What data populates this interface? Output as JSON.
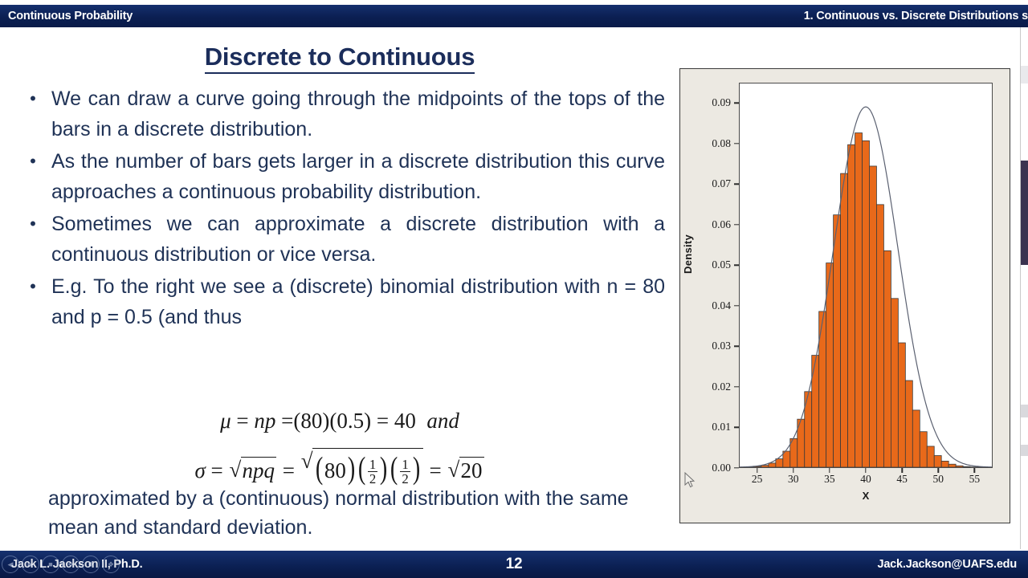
{
  "header": {
    "left_title": "Continuous Probability",
    "right_title": "1.  Continuous vs. Discrete Distributions s"
  },
  "slide": {
    "title": "Discrete to Continuous",
    "bullets": [
      "We can draw a curve going through the midpoints of the tops of the bars in a discrete distribution.",
      "As the number of bars gets larger in a discrete distribution this curve approaches a continuous probability distribution.",
      "Sometimes we can approximate a discrete distribution with a continuous distribution or vice versa.",
      "E.g. To the right we see a (discrete) binomial distribution with n = 80 and p = 0.5 (and thus"
    ],
    "bullet_marker": "•",
    "equation_1": "μ = np = (80)(0.5) = 40  and",
    "equation_1_parts": {
      "mu": "μ",
      "eq1": "=",
      "np": "np",
      "eq2": "=",
      "lparen": "(",
      "eighty": "80",
      "rparen": ")",
      "lparen2": "(",
      "phalf": "0.5",
      "rparen2": ")",
      "eq3": "=",
      "forty": "40",
      "and": "and"
    },
    "equation_2": "σ = √npq = √((80)(1/2)(1/2)) = √20",
    "equation_2_parts": {
      "sigma": "σ",
      "eq1": "=",
      "npq": "npq",
      "eq2": "=",
      "eighty": "80",
      "num": "1",
      "den": "2",
      "eq3": "=",
      "twenty": "20",
      "radical": "√"
    },
    "tail_text": "approximated by a (continuous) normal distribution with the same mean and standard deviation."
  },
  "chart_data": {
    "type": "bar",
    "title": "",
    "xlabel": "X",
    "ylabel": "Density",
    "xlim": [
      22.5,
      57.5
    ],
    "ylim": [
      0.0,
      0.095
    ],
    "xticks": [
      "25",
      "30",
      "35",
      "40",
      "45",
      "50",
      "55"
    ],
    "xtick_values": [
      25,
      30,
      35,
      40,
      45,
      50,
      55
    ],
    "yticks": [
      "0.00",
      "0.01",
      "0.02",
      "0.03",
      "0.04",
      "0.05",
      "0.06",
      "0.07",
      "0.08",
      "0.09"
    ],
    "ytick_values": [
      0.0,
      0.01,
      0.02,
      0.03,
      0.04,
      0.05,
      0.06,
      0.07,
      0.08,
      0.09
    ],
    "grid": false,
    "legend": "none",
    "bar_color": "#E8691A",
    "bar_edge_color": "#3a3a3a",
    "curve_color": "#5a6070",
    "overlay": "normal-curve",
    "distribution": "Binomial(n=80, p=0.5) with Normal(mu=40, sigma=sqrt(20)) overlay",
    "categories": [
      23,
      24,
      25,
      26,
      27,
      28,
      29,
      30,
      31,
      32,
      33,
      34,
      35,
      36,
      37,
      38,
      39,
      40,
      41,
      42,
      43,
      44,
      45,
      46,
      47,
      48,
      49,
      50,
      51,
      52,
      53,
      54,
      55,
      56,
      57
    ],
    "values": [
      3e-05,
      8e-05,
      0.0002,
      0.00047,
      0.00102,
      0.00208,
      0.00397,
      0.00709,
      0.01189,
      0.01872,
      0.02771,
      0.03857,
      0.05057,
      0.06247,
      0.07272,
      0.07985,
      0.08277,
      0.08082,
      0.07454,
      0.06502,
      0.05359,
      0.04178,
      0.0308,
      0.02146,
      0.01413,
      0.0088,
      0.00518,
      0.00288,
      0.00151,
      0.00075,
      0.00035,
      0.00015,
      6e-05,
      2e-05,
      1e-05
    ]
  },
  "footer": {
    "author": "Jack L. Jackson II, Ph.D.",
    "page_number": "12",
    "email": "Jack.Jackson@UAFS.edu",
    "nav_glyphs": [
      "◀",
      "▶",
      "■",
      "❖",
      "❖",
      "❖"
    ]
  }
}
